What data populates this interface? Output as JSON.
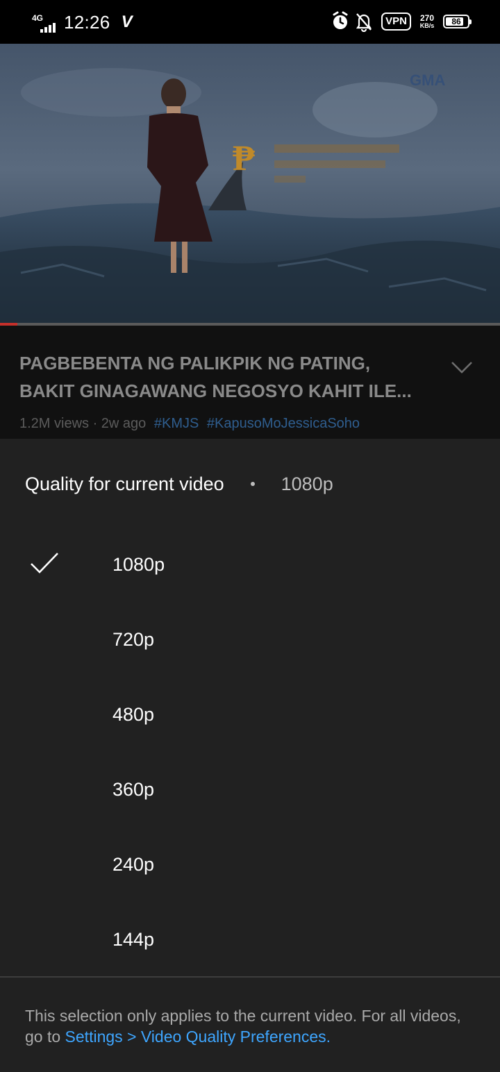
{
  "status_bar": {
    "network": "4G",
    "time": "12:26",
    "carrier_logo": "V",
    "vpn": "VPN",
    "speed_value": "270",
    "speed_unit": "KB/s",
    "battery": "86",
    "battery_level": 0.86,
    "icons": [
      "signal-icon",
      "alarm-icon",
      "bell-off-icon",
      "battery-icon"
    ]
  },
  "video": {
    "progress": 0.035,
    "progress_color": "#c4302b"
  },
  "info": {
    "title": "PAGBEBENTA NG PALIKPIK NG PATING, BAKIT GINAGAWANG NEGOSYO KAHIT ILE...",
    "views": "1.2M views · 2w ago",
    "hashtags": [
      "#KMJS",
      "#KapusoMoJessicaSoho"
    ],
    "link_color": "#2f5e8f"
  },
  "quality_sheet": {
    "title": "Quality for current video",
    "current": "1080p",
    "options": [
      {
        "label": "1080p",
        "selected": true
      },
      {
        "label": "720p",
        "selected": false
      },
      {
        "label": "480p",
        "selected": false
      },
      {
        "label": "360p",
        "selected": false
      },
      {
        "label": "240p",
        "selected": false
      },
      {
        "label": "144p",
        "selected": false
      }
    ],
    "note": "This selection only applies to the current video. For all videos, go to ",
    "note_link": "Settings > Video Quality Preferences.",
    "link_color": "#3ea6ff"
  }
}
